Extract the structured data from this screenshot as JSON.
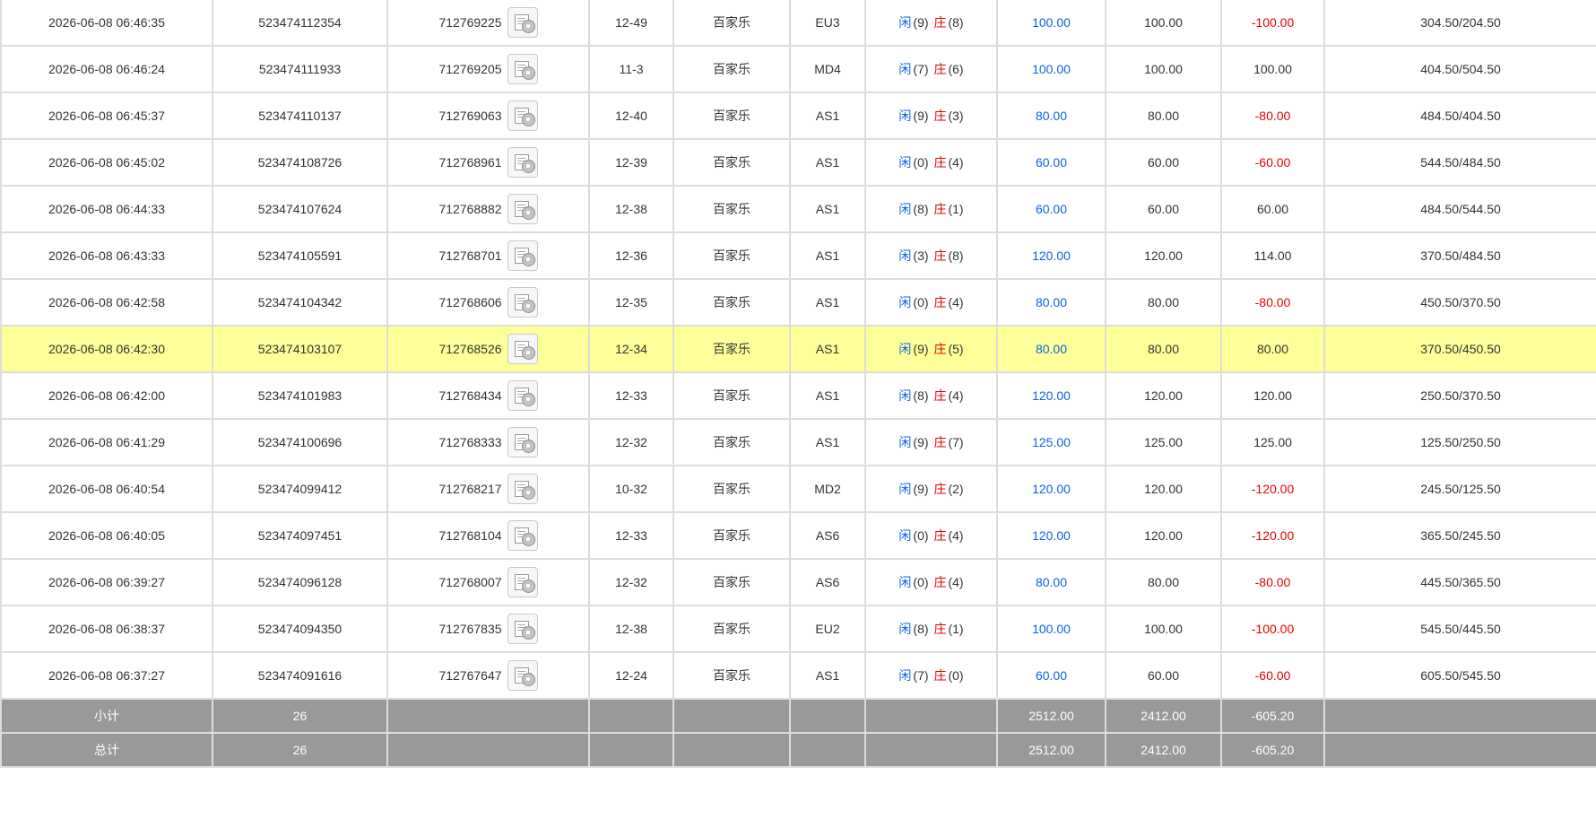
{
  "table": {
    "rows": [
      {
        "time": "2026-06-08 06:46:35",
        "order_id": "523474112354",
        "game_no": "712769225",
        "shoe": "12-49",
        "game": "百家乐",
        "table": "EU3",
        "player_label": "闲",
        "player_score": "(9)",
        "banker_label": "庄",
        "banker_score": "(8)",
        "bet": "100.00",
        "valid": "100.00",
        "win": "-100.00",
        "win_color": "red",
        "balance": "304.50/204.50"
      },
      {
        "time": "2026-06-08 06:46:24",
        "order_id": "523474111933",
        "game_no": "712769205",
        "shoe": "11-3",
        "game": "百家乐",
        "table": "MD4",
        "player_label": "闲",
        "player_score": "(7)",
        "banker_label": "庄",
        "banker_score": "(6)",
        "bet": "100.00",
        "valid": "100.00",
        "win": "100.00",
        "win_color": "normal",
        "balance": "404.50/504.50"
      },
      {
        "time": "2026-06-08 06:45:37",
        "order_id": "523474110137",
        "game_no": "712769063",
        "shoe": "12-40",
        "game": "百家乐",
        "table": "AS1",
        "player_label": "闲",
        "player_score": "(9)",
        "banker_label": "庄",
        "banker_score": "(3)",
        "bet": "80.00",
        "valid": "80.00",
        "win": "-80.00",
        "win_color": "red",
        "balance": "484.50/404.50"
      },
      {
        "time": "2026-06-08 06:45:02",
        "order_id": "523474108726",
        "game_no": "712768961",
        "shoe": "12-39",
        "game": "百家乐",
        "table": "AS1",
        "player_label": "闲",
        "player_score": "(0)",
        "banker_label": "庄",
        "banker_score": "(4)",
        "bet": "60.00",
        "valid": "60.00",
        "win": "-60.00",
        "win_color": "red",
        "balance": "544.50/484.50"
      },
      {
        "time": "2026-06-08 06:44:33",
        "order_id": "523474107624",
        "game_no": "712768882",
        "shoe": "12-38",
        "game": "百家乐",
        "table": "AS1",
        "player_label": "闲",
        "player_score": "(8)",
        "banker_label": "庄",
        "banker_score": "(1)",
        "bet": "60.00",
        "valid": "60.00",
        "win": "60.00",
        "win_color": "normal",
        "balance": "484.50/544.50"
      },
      {
        "time": "2026-06-08 06:43:33",
        "order_id": "523474105591",
        "game_no": "712768701",
        "shoe": "12-36",
        "game": "百家乐",
        "table": "AS1",
        "player_label": "闲",
        "player_score": "(3)",
        "banker_label": "庄",
        "banker_score": "(8)",
        "bet": "120.00",
        "valid": "120.00",
        "win": "114.00",
        "win_color": "normal",
        "balance": "370.50/484.50"
      },
      {
        "time": "2026-06-08 06:42:58",
        "order_id": "523474104342",
        "game_no": "712768606",
        "shoe": "12-35",
        "game": "百家乐",
        "table": "AS1",
        "player_label": "闲",
        "player_score": "(0)",
        "banker_label": "庄",
        "banker_score": "(4)",
        "bet": "80.00",
        "valid": "80.00",
        "win": "-80.00",
        "win_color": "red",
        "balance": "450.50/370.50"
      },
      {
        "time": "2026-06-08 06:42:30",
        "order_id": "523474103107",
        "game_no": "712768526",
        "shoe": "12-34",
        "game": "百家乐",
        "table": "AS1",
        "player_label": "闲",
        "player_score": "(9)",
        "banker_label": "庄",
        "banker_score": "(5)",
        "bet": "80.00",
        "valid": "80.00",
        "win": "80.00",
        "win_color": "normal",
        "balance": "370.50/450.50",
        "highlight": true
      },
      {
        "time": "2026-06-08 06:42:00",
        "order_id": "523474101983",
        "game_no": "712768434",
        "shoe": "12-33",
        "game": "百家乐",
        "table": "AS1",
        "player_label": "闲",
        "player_score": "(8)",
        "banker_label": "庄",
        "banker_score": "(4)",
        "bet": "120.00",
        "valid": "120.00",
        "win": "120.00",
        "win_color": "normal",
        "balance": "250.50/370.50"
      },
      {
        "time": "2026-06-08 06:41:29",
        "order_id": "523474100696",
        "game_no": "712768333",
        "shoe": "12-32",
        "game": "百家乐",
        "table": "AS1",
        "player_label": "闲",
        "player_score": "(9)",
        "banker_label": "庄",
        "banker_score": "(7)",
        "bet": "125.00",
        "valid": "125.00",
        "win": "125.00",
        "win_color": "normal",
        "balance": "125.50/250.50"
      },
      {
        "time": "2026-06-08 06:40:54",
        "order_id": "523474099412",
        "game_no": "712768217",
        "shoe": "10-32",
        "game": "百家乐",
        "table": "MD2",
        "player_label": "闲",
        "player_score": "(9)",
        "banker_label": "庄",
        "banker_score": "(2)",
        "bet": "120.00",
        "valid": "120.00",
        "win": "-120.00",
        "win_color": "red",
        "balance": "245.50/125.50"
      },
      {
        "time": "2026-06-08 06:40:05",
        "order_id": "523474097451",
        "game_no": "712768104",
        "shoe": "12-33",
        "game": "百家乐",
        "table": "AS6",
        "player_label": "闲",
        "player_score": "(0)",
        "banker_label": "庄",
        "banker_score": "(4)",
        "bet": "120.00",
        "valid": "120.00",
        "win": "-120.00",
        "win_color": "red",
        "balance": "365.50/245.50"
      },
      {
        "time": "2026-06-08 06:39:27",
        "order_id": "523474096128",
        "game_no": "712768007",
        "shoe": "12-32",
        "game": "百家乐",
        "table": "AS6",
        "player_label": "闲",
        "player_score": "(0)",
        "banker_label": "庄",
        "banker_score": "(4)",
        "bet": "80.00",
        "valid": "80.00",
        "win": "-80.00",
        "win_color": "red",
        "balance": "445.50/365.50"
      },
      {
        "time": "2026-06-08 06:38:37",
        "order_id": "523474094350",
        "game_no": "712767835",
        "shoe": "12-38",
        "game": "百家乐",
        "table": "EU2",
        "player_label": "闲",
        "player_score": "(8)",
        "banker_label": "庄",
        "banker_score": "(1)",
        "bet": "100.00",
        "valid": "100.00",
        "win": "-100.00",
        "win_color": "red",
        "balance": "545.50/445.50"
      },
      {
        "time": "2026-06-08 06:37:27",
        "order_id": "523474091616",
        "game_no": "712767647",
        "shoe": "12-24",
        "game": "百家乐",
        "table": "AS1",
        "player_label": "闲",
        "player_score": "(7)",
        "banker_label": "庄",
        "banker_score": "(0)",
        "bet": "60.00",
        "valid": "60.00",
        "win": "-60.00",
        "win_color": "red",
        "balance": "605.50/545.50"
      }
    ],
    "summary": [
      {
        "label": "小计",
        "count": "26",
        "bet": "2512.00",
        "valid": "2412.00",
        "win": "-605.20"
      },
      {
        "label": "总计",
        "count": "26",
        "bet": "2512.00",
        "valid": "2412.00",
        "win": "-605.20"
      }
    ],
    "icon": "bet-detail-icon",
    "colors": {
      "blue": "#0b63e6",
      "red": "#e60000",
      "highlight": "#ffff99",
      "summary_bg": "#999999"
    }
  }
}
